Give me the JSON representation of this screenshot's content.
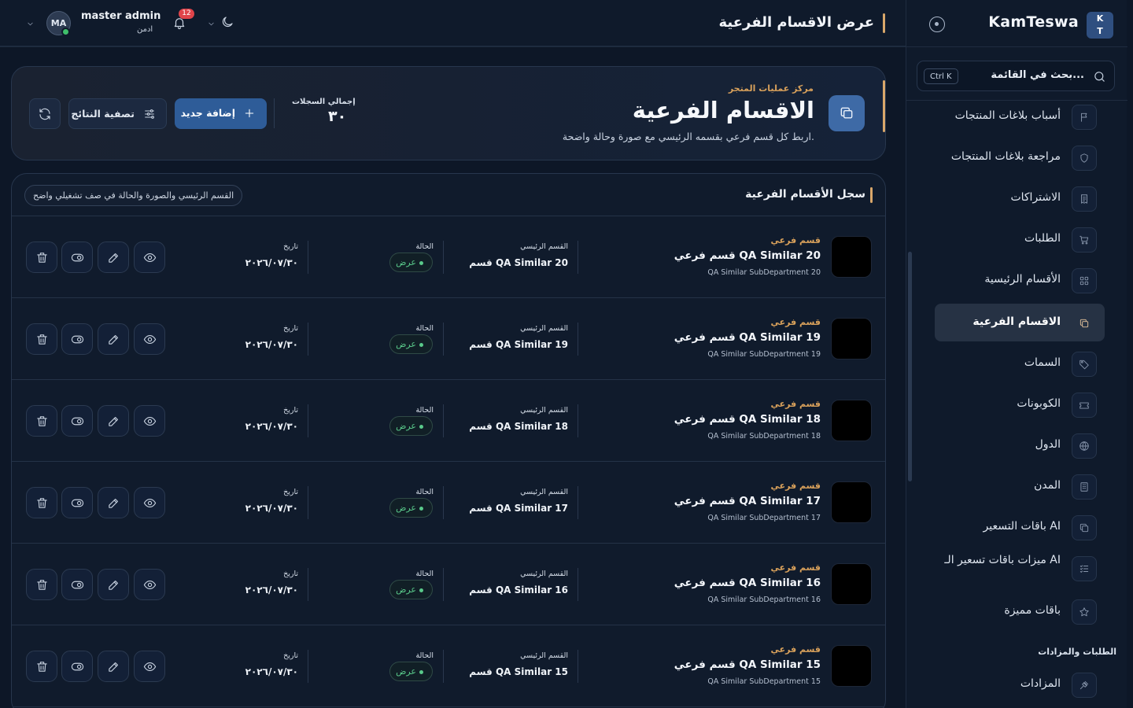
{
  "topbar": {
    "page_title": "عرض الاقسام الفرعية",
    "notifications_count": "12",
    "user": {
      "name": "master admin",
      "role": "ادمن",
      "initials": "MA"
    }
  },
  "sidebar": {
    "brand": {
      "logo_top": "K",
      "logo_bottom": "T",
      "name": "KamTeswa"
    },
    "search": {
      "placeholder": "بحث في القائمة...",
      "shortcut": "Ctrl K"
    },
    "items": [
      {
        "label": "أسباب بلاغات المنتجات",
        "icon": "flag-icon"
      },
      {
        "label": "مراجعة بلاغات المنتجات",
        "icon": "shield-icon"
      },
      {
        "label": "الاشتراكات",
        "icon": "receipt-icon"
      },
      {
        "label": "الطلبات",
        "icon": "cart-icon"
      },
      {
        "label": "الأقسام الرئيسية",
        "icon": "grid-icon"
      },
      {
        "label": "الاقسام الفرعية",
        "icon": "copy-icon",
        "active": true
      },
      {
        "label": "السمات",
        "icon": "tag-icon"
      },
      {
        "label": "الكوبونات",
        "icon": "ticket-icon"
      },
      {
        "label": "الدول",
        "icon": "globe-icon"
      },
      {
        "label": "المدن",
        "icon": "building-icon"
      },
      {
        "label": "باقات التسعير AI",
        "icon": "copy-icon"
      },
      {
        "label": "ميزات باقات تسعير الـ AI",
        "icon": "list-check-icon"
      },
      {
        "label": "باقات مميزة",
        "icon": "star-icon"
      }
    ],
    "section_title": "الطلبات والمزادات",
    "section_items": [
      {
        "label": "المزادات",
        "icon": "gavel-icon"
      }
    ]
  },
  "hero": {
    "eyebrow": "مركز عمليات المتجر",
    "title": "الاقسام الفرعية",
    "subtitle": "اربط كل قسم فرعي بقسمه الرئيسي مع صورة وحالة واضحة.",
    "total_label": "إجمالي السجلات",
    "total_value": "٣٠",
    "add_button": "إضافة جديد",
    "filter_button": "تصفية النتائج"
  },
  "list": {
    "title": "سجل الأقسام الفرعية",
    "hint_chip": "القسم الرئيسي والصورة والحالة في صف تشغيلي واضح",
    "columns": {
      "main_dept": "القسم الرئيسي",
      "status": "الحالة",
      "date": "تاريخ"
    },
    "rows": [
      {
        "kind": "قسم فرعي",
        "name": "قسم فرعي QA Similar 20",
        "sub": "QA Similar SubDepartment 20",
        "main_dept": "قسم QA Similar 20",
        "status": "عرض",
        "date": "٢٠٢٦/٠٧/٣٠"
      },
      {
        "kind": "قسم فرعي",
        "name": "قسم فرعي QA Similar 19",
        "sub": "QA Similar SubDepartment 19",
        "main_dept": "قسم QA Similar 19",
        "status": "عرض",
        "date": "٢٠٢٦/٠٧/٣٠"
      },
      {
        "kind": "قسم فرعي",
        "name": "قسم فرعي QA Similar 18",
        "sub": "QA Similar SubDepartment 18",
        "main_dept": "قسم QA Similar 18",
        "status": "عرض",
        "date": "٢٠٢٦/٠٧/٣٠"
      },
      {
        "kind": "قسم فرعي",
        "name": "قسم فرعي QA Similar 17",
        "sub": "QA Similar SubDepartment 17",
        "main_dept": "قسم QA Similar 17",
        "status": "عرض",
        "date": "٢٠٢٦/٠٧/٣٠"
      },
      {
        "kind": "قسم فرعي",
        "name": "قسم فرعي QA Similar 16",
        "sub": "QA Similar SubDepartment 16",
        "main_dept": "قسم QA Similar 16",
        "status": "عرض",
        "date": "٢٠٢٦/٠٧/٣٠"
      },
      {
        "kind": "قسم فرعي",
        "name": "قسم فرعي QA Similar 15",
        "sub": "QA Similar SubDepartment 15",
        "main_dept": "قسم QA Similar 15",
        "status": "عرض",
        "date": "٢٠٢٦/٠٧/٣٠"
      }
    ],
    "actions": [
      {
        "name": "view-button",
        "icon": "eye-icon"
      },
      {
        "name": "edit-button",
        "icon": "pencil-icon"
      },
      {
        "name": "toggle-button",
        "icon": "toggle-icon"
      },
      {
        "name": "delete-button",
        "icon": "trash-icon"
      }
    ]
  },
  "colors": {
    "accent": "#d9a76a",
    "primary": "#2e5c98",
    "success": "#59c98a",
    "background": "#0d1727"
  }
}
